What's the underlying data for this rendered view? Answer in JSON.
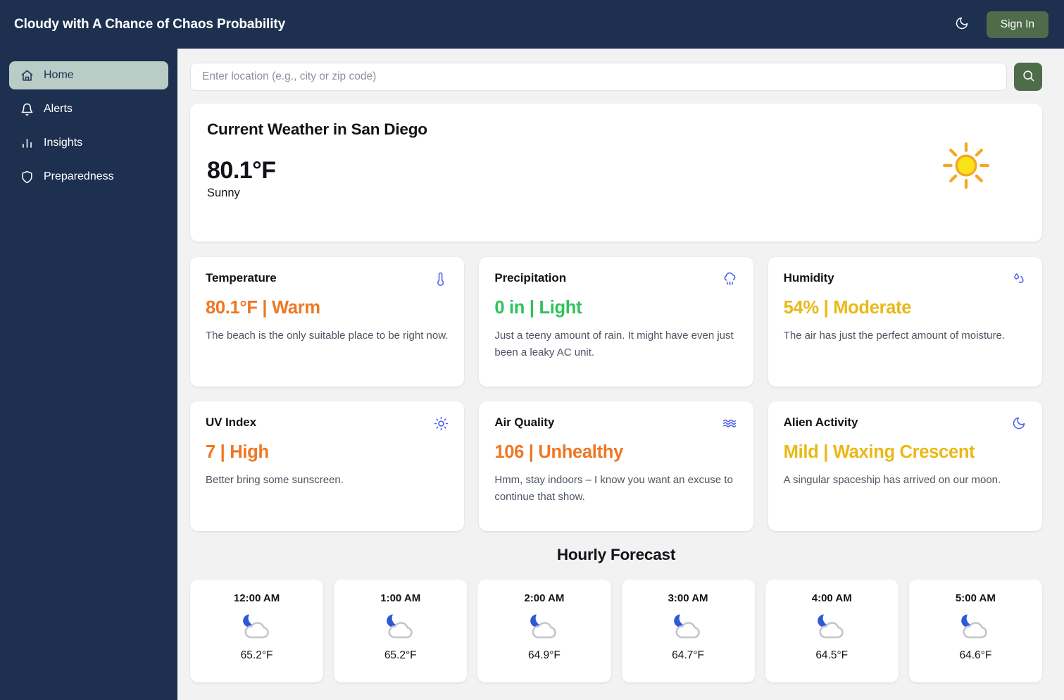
{
  "header": {
    "title": "Cloudy with A Chance of Chaos Probability",
    "theme_toggle_icon": "moon-icon",
    "signin_label": "Sign In",
    "signin_color": "#4e6b4a",
    "background": "#1e3050"
  },
  "sidebar": {
    "items": [
      {
        "label": "Home",
        "icon": "home-icon",
        "active": true
      },
      {
        "label": "Alerts",
        "icon": "bell-icon",
        "active": false
      },
      {
        "label": "Insights",
        "icon": "bar-chart-icon",
        "active": false
      },
      {
        "label": "Preparedness",
        "icon": "shield-icon",
        "active": false
      }
    ],
    "active_background": "#b9ccc6"
  },
  "search": {
    "placeholder": "Enter location (e.g., city or zip code)",
    "value": "",
    "button_icon": "search-icon"
  },
  "current": {
    "title": "Current Weather in San Diego",
    "temperature": "80.1°F",
    "condition": "Sunny",
    "icon": "sun-icon"
  },
  "metrics": [
    {
      "label": "Temperature",
      "value": "80.1°F | Warm",
      "description": "The beach is the only suitable place to be right now.",
      "icon": "thermometer-icon",
      "color": "#ee7723"
    },
    {
      "label": "Precipitation",
      "value": "0 in | Light",
      "description": "Just a teeny amount of rain. It might have even just been a leaky AC unit.",
      "icon": "cloud-rain-icon",
      "color": "#2ec25e"
    },
    {
      "label": "Humidity",
      "value": "54% | Moderate",
      "description": "The air has just the perfect amount of moisture.",
      "icon": "droplets-icon",
      "color": "#eab816"
    },
    {
      "label": "UV Index",
      "value": "7 | High",
      "description": "Better bring some sunscreen.",
      "icon": "sun-small-icon",
      "color": "#ee7723"
    },
    {
      "label": "Air Quality",
      "value": "106 | Unhealthy",
      "description": "Hmm, stay indoors – I know you want an excuse to continue that show.",
      "icon": "waves-icon",
      "color": "#ee7723"
    },
    {
      "label": "Alien Activity",
      "value": "Mild | Waxing Crescent",
      "description": "A singular spaceship has arrived on our moon.",
      "icon": "moon-icon",
      "color": "#eab816"
    }
  ],
  "hourly": {
    "title": "Hourly Forecast",
    "entries": [
      {
        "time": "12:00 AM",
        "temp": "65.2°F",
        "icon": "moon-cloud-icon"
      },
      {
        "time": "1:00 AM",
        "temp": "65.2°F",
        "icon": "moon-cloud-icon"
      },
      {
        "time": "2:00 AM",
        "temp": "64.9°F",
        "icon": "moon-cloud-icon"
      },
      {
        "time": "3:00 AM",
        "temp": "64.7°F",
        "icon": "moon-cloud-icon"
      },
      {
        "time": "4:00 AM",
        "temp": "64.5°F",
        "icon": "moon-cloud-icon"
      },
      {
        "time": "5:00 AM",
        "temp": "64.6°F",
        "icon": "moon-cloud-icon"
      }
    ]
  }
}
